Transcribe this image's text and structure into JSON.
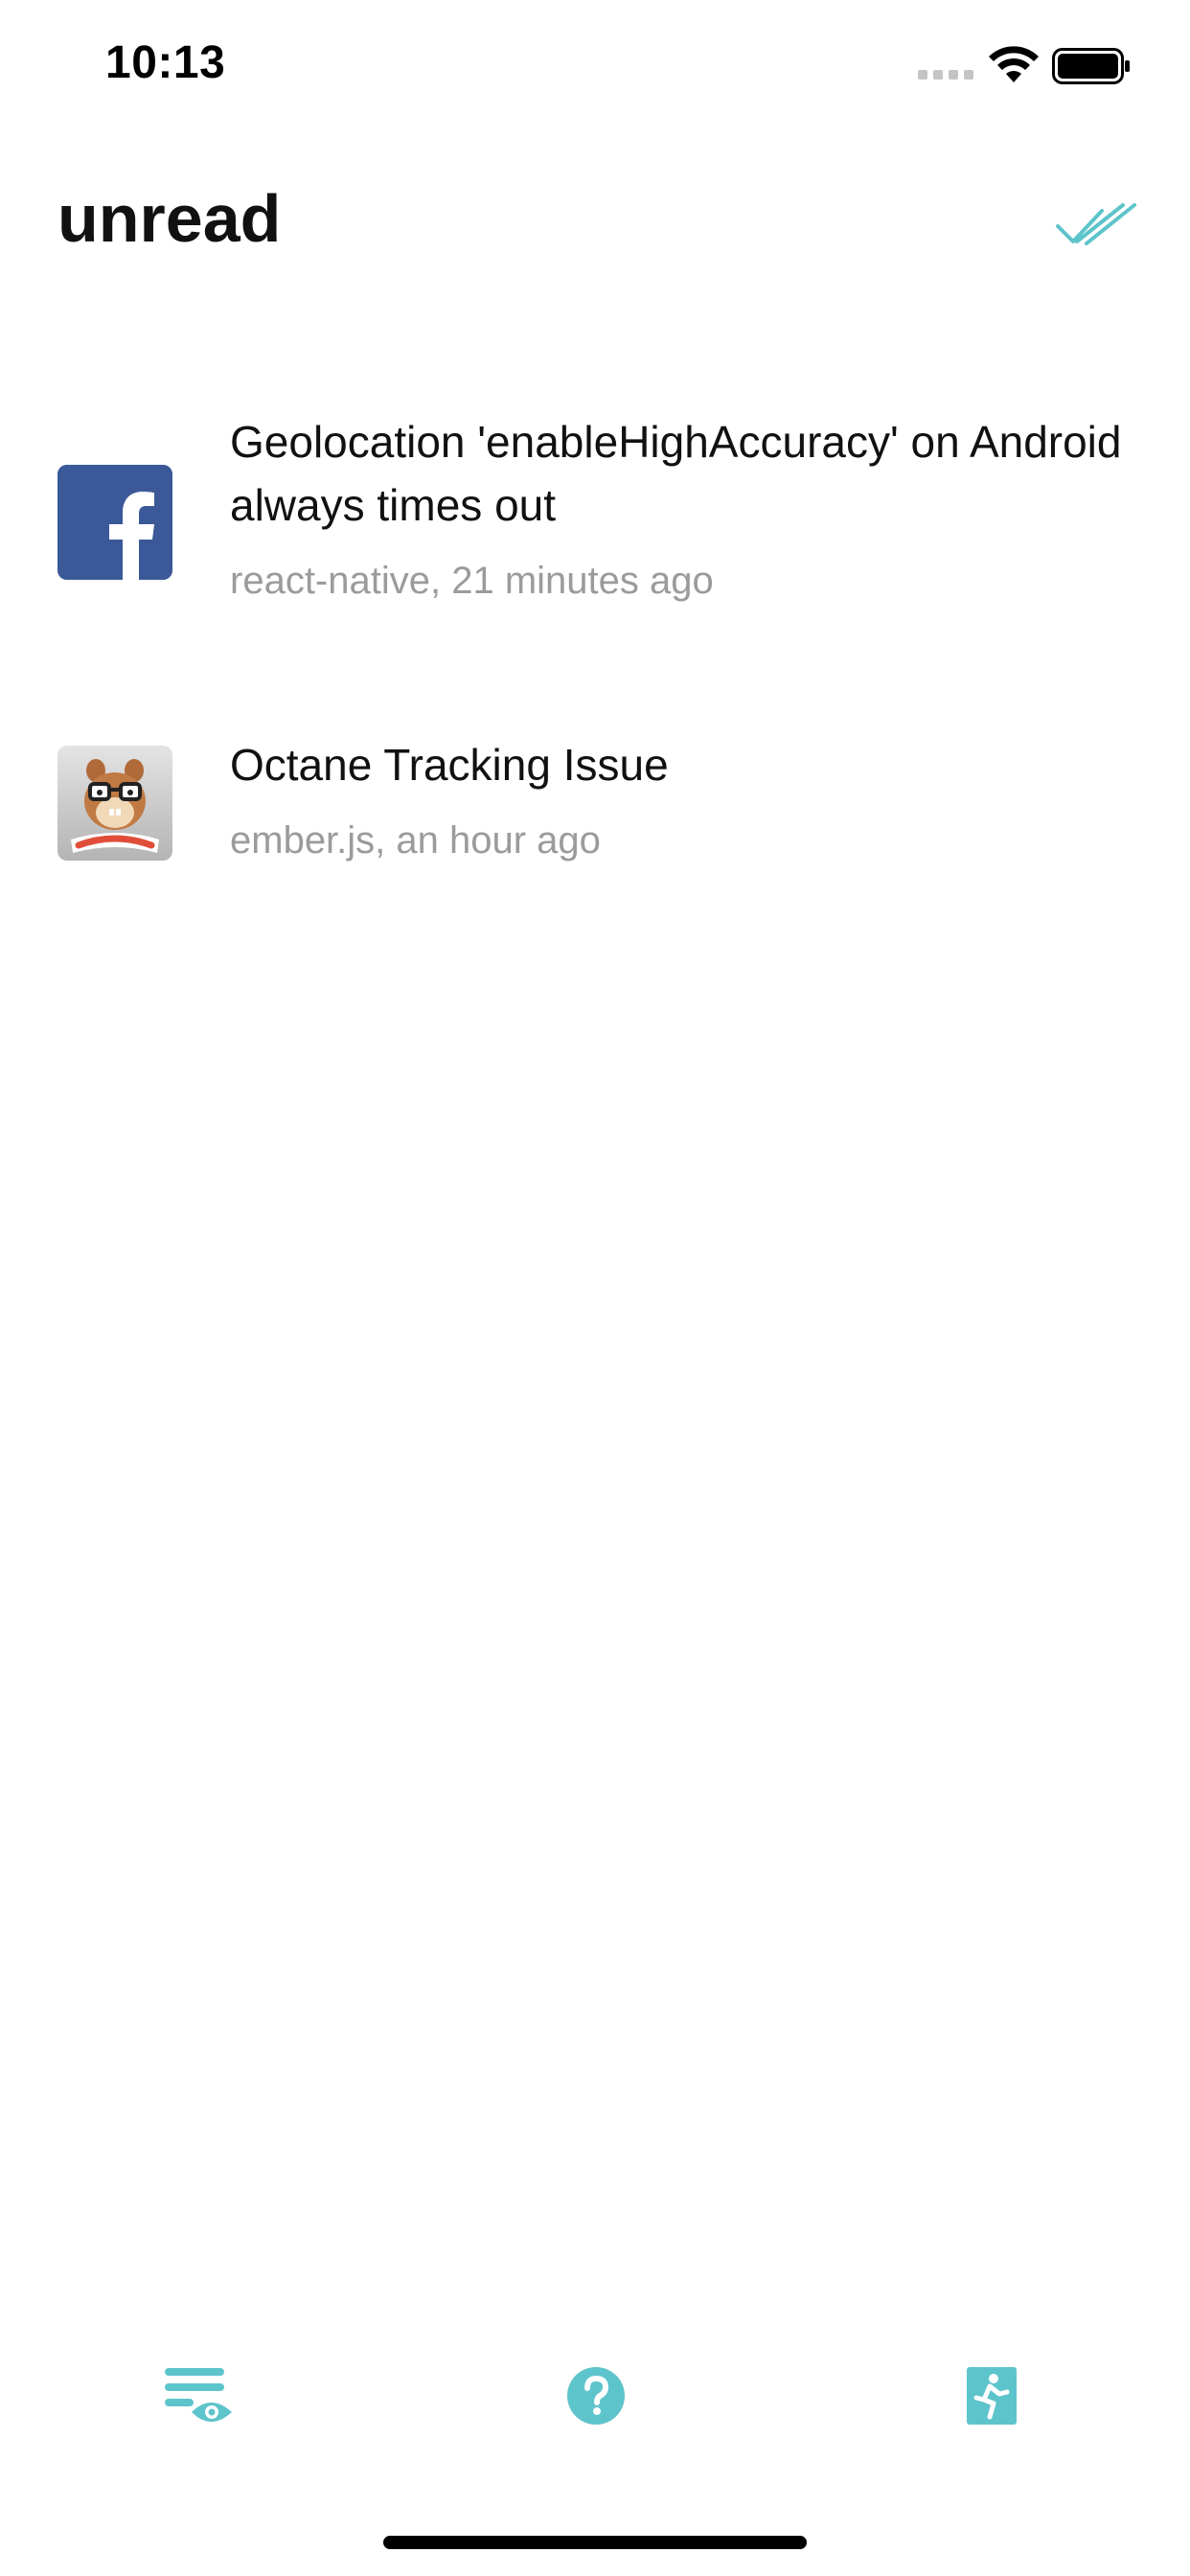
{
  "status_bar": {
    "time": "10:13",
    "icons": [
      "signal-icon",
      "wifi-icon",
      "battery-icon"
    ]
  },
  "header": {
    "title": "unread",
    "action_icon": "double-check-icon"
  },
  "notifications": [
    {
      "title": "Geolocation 'enableHighAccuracy' on Android always times out",
      "meta": "react-native, 21 minutes ago",
      "avatar": "facebook-logo"
    },
    {
      "title": "Octane Tracking Issue",
      "meta": "ember.js, an hour ago",
      "avatar": "ember-logo"
    }
  ],
  "tab_bar": {
    "icons": [
      "list-eye-icon",
      "help-icon",
      "exit-icon"
    ]
  },
  "colors": {
    "accent": "#5ec4cb",
    "facebook_blue": "#3b5998",
    "meta_gray": "#9b9b9b"
  }
}
